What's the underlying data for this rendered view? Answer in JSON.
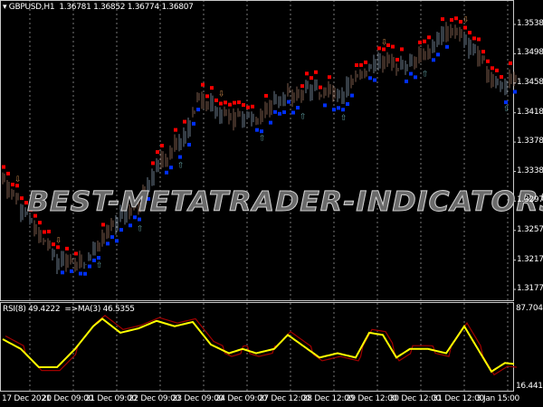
{
  "header": {
    "symbol": "GBPUSD,H1",
    "open": "1.36781",
    "high": "1.36852",
    "low": "1.36774",
    "close": "1.36807"
  },
  "watermark": "BEST-METATRADER-INDICATORS.COM",
  "price_axis": [
    "1.35385",
    "1.34985",
    "1.34585",
    "1.34180",
    "1.33780",
    "1.33380",
    "1.32975",
    "1.32575",
    "1.32170",
    "1.31770"
  ],
  "rsi": {
    "label": "RSI(8) 49.4222",
    "ma_label": "=>MA(3) 46.5355",
    "max": "87.7049",
    "min": "16.4413"
  },
  "time_axis": [
    "17 Dec 2021",
    "20 Dec 09:00",
    "21 Dec 09:00",
    "22 Dec 09:00",
    "23 Dec 09:00",
    "24 Dec 09:00",
    "27 Dec 12:00",
    "28 Dec 12:00",
    "29 Dec 12:00",
    "30 Dec 12:00",
    "31 Dec 12:00",
    "3 Jan 15:00"
  ],
  "colors": {
    "background": "#000000",
    "grid": "#c8c8c8",
    "bars": "#7a5a4a",
    "sell_dot": "#ff0000",
    "buy_dot": "#0030ff",
    "rsi": "#ffff00",
    "rsi_ma": "#a00000",
    "up_arrow": "#5f9ea0",
    "down_arrow": "#c8864a"
  },
  "chart_data": {
    "type": "line",
    "price_path": [
      [
        0,
        1.3326
      ],
      [
        8,
        1.3252
      ],
      [
        12,
        1.3215
      ],
      [
        18,
        1.3215
      ],
      [
        24,
        1.3264
      ],
      [
        30,
        1.3289
      ],
      [
        34,
        1.335
      ],
      [
        40,
        1.3387
      ],
      [
        43,
        1.3436
      ],
      [
        48,
        1.3418
      ],
      [
        56,
        1.3412
      ],
      [
        62,
        1.3442
      ],
      [
        70,
        1.3448
      ],
      [
        76,
        1.3448
      ],
      [
        82,
        1.3491
      ],
      [
        88,
        1.3485
      ],
      [
        94,
        1.3504
      ],
      [
        100,
        1.3535
      ],
      [
        104,
        1.3504
      ],
      [
        109,
        1.3455
      ],
      [
        113,
        1.3467
      ]
    ],
    "rsi_path": [
      [
        0,
        60
      ],
      [
        4,
        51
      ],
      [
        8,
        34
      ],
      [
        12,
        34
      ],
      [
        16,
        51
      ],
      [
        20,
        72
      ],
      [
        22,
        79
      ],
      [
        26,
        66
      ],
      [
        30,
        70
      ],
      [
        34,
        77
      ],
      [
        38,
        72
      ],
      [
        42,
        76
      ],
      [
        46,
        55
      ],
      [
        50,
        47
      ],
      [
        53,
        51
      ],
      [
        56,
        47
      ],
      [
        60,
        51
      ],
      [
        63,
        64
      ],
      [
        66,
        55
      ],
      [
        70,
        43
      ],
      [
        74,
        47
      ],
      [
        78,
        43
      ],
      [
        81,
        66
      ],
      [
        84,
        64
      ],
      [
        87,
        43
      ],
      [
        90,
        51
      ],
      [
        94,
        51
      ],
      [
        98,
        47
      ],
      [
        102,
        72
      ],
      [
        105,
        51
      ],
      [
        108,
        30
      ],
      [
        111,
        38
      ],
      [
        113,
        37
      ]
    ]
  }
}
